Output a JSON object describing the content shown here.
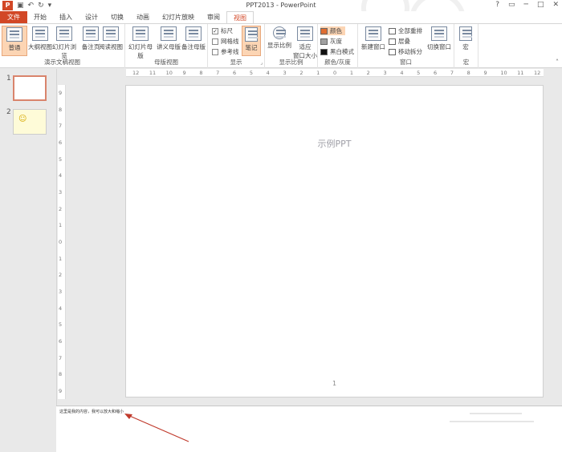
{
  "window": {
    "title": "PPT2013 - PowerPoint",
    "app_logo": "P",
    "qat_icons": [
      "save-icon",
      "undo-icon",
      "redo-icon",
      "more-icon"
    ],
    "controls": [
      "?",
      "□",
      "─",
      "□",
      "✕"
    ]
  },
  "tabs": [
    {
      "label": "文件"
    },
    {
      "label": "开始"
    },
    {
      "label": "插入"
    },
    {
      "label": "设计"
    },
    {
      "label": "切换"
    },
    {
      "label": "动画"
    },
    {
      "label": "幻灯片放映"
    },
    {
      "label": "审阅"
    },
    {
      "label": "视图"
    }
  ],
  "ribbon": {
    "presentation_views": {
      "label": "演示文稿视图",
      "buttons": [
        "普通",
        "大纲视图",
        "幻灯片浏览",
        "备注页",
        "阅读视图"
      ]
    },
    "master_views": {
      "label": "母版视图",
      "buttons": [
        "幻灯片母版",
        "讲义母版",
        "备注母版"
      ]
    },
    "show": {
      "label": "显示",
      "checks": [
        {
          "label": "标尺",
          "checked": true
        },
        {
          "label": "网格线",
          "checked": false
        },
        {
          "label": "参考线",
          "checked": false
        }
      ],
      "notes_button": "笔记"
    },
    "zoom": {
      "label": "显示比例",
      "zoom_button": "显示比例",
      "fit_button_line1": "适应",
      "fit_button_line2": "窗口大小"
    },
    "color": {
      "label": "颜色/灰度",
      "items": [
        {
          "label": "颜色",
          "color": "#e06c2f"
        },
        {
          "label": "灰度",
          "color": "#a0a0a0"
        },
        {
          "label": "黑白模式",
          "color": "#111111"
        }
      ]
    },
    "window": {
      "label": "窗口",
      "new_window": "新建窗口",
      "items": [
        "全部重排",
        "层叠",
        "移动拆分"
      ],
      "switch_window": "切换窗口"
    },
    "macros": {
      "label": "宏",
      "button": "宏"
    }
  },
  "ruler": {
    "h_ticks": [
      "12",
      "11",
      "10",
      "9",
      "8",
      "7",
      "6",
      "5",
      "4",
      "3",
      "2",
      "1",
      "0",
      "1",
      "2",
      "3",
      "4",
      "5",
      "6",
      "7",
      "8",
      "9",
      "10",
      "11",
      "12"
    ],
    "v_ticks": [
      "9",
      "8",
      "7",
      "6",
      "5",
      "4",
      "3",
      "2",
      "1",
      "0",
      "1",
      "2",
      "3",
      "4",
      "5",
      "6",
      "7",
      "8",
      "9"
    ]
  },
  "thumbnails": [
    {
      "number": "1"
    },
    {
      "number": "2"
    }
  ],
  "slide": {
    "title": "示例PPT",
    "page_number": "1"
  },
  "notes": {
    "text": "这里是我的内容，我可以放大和缩小"
  },
  "colors": {
    "accent": "#d24726",
    "selected": "#fcd5b4"
  }
}
